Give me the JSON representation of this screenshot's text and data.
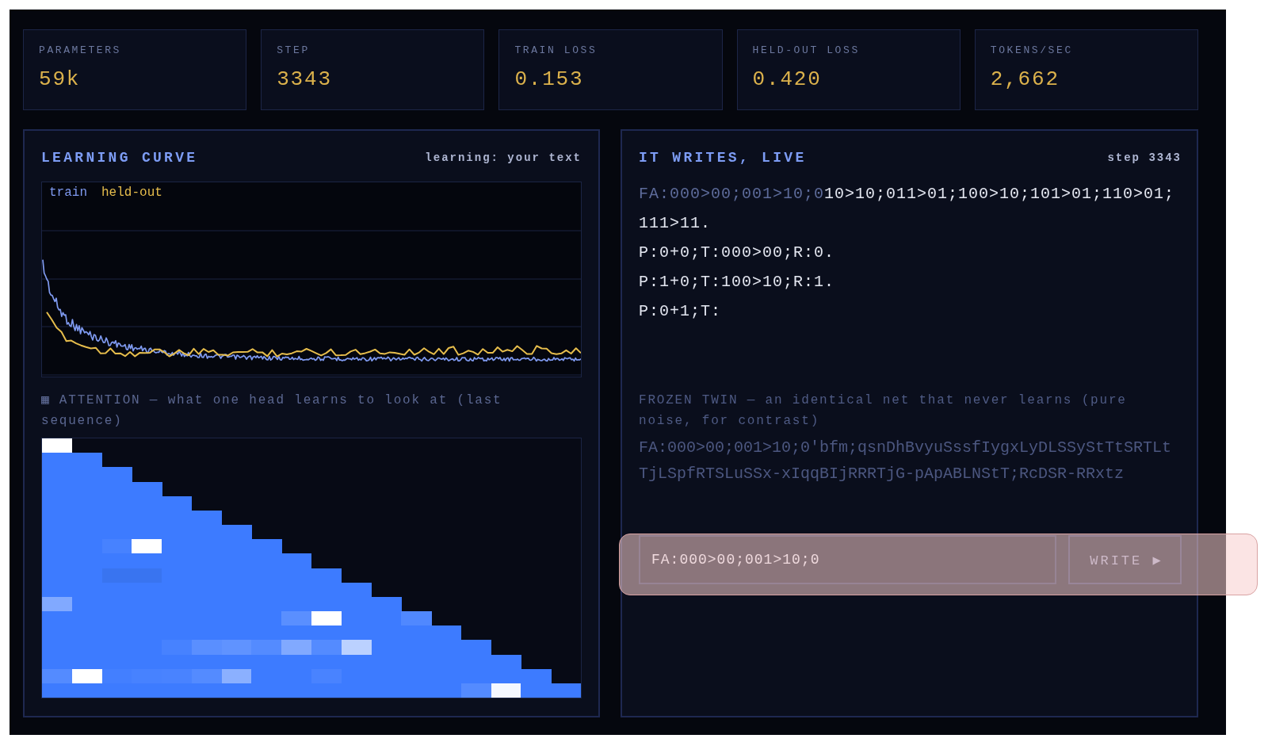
{
  "stats": [
    {
      "label": "PARAMETERS",
      "value": "59k"
    },
    {
      "label": "STEP",
      "value": "3343"
    },
    {
      "label": "TRAIN LOSS",
      "value": "0.153"
    },
    {
      "label": "HELD-OUT LOSS",
      "value": "0.420"
    },
    {
      "label": "TOKENS/SEC",
      "value": "2,662"
    }
  ],
  "learning_curve": {
    "title": "LEARNING CURVE",
    "source": "learning: your text",
    "legend": [
      {
        "label": "train",
        "color": "#7f9af0"
      },
      {
        "label": "held-out",
        "color": "#e6bd4c"
      }
    ]
  },
  "attention": {
    "caption": "▦ ATTENTION — what one head learns to look at (last sequence)"
  },
  "live_output": {
    "title": "IT WRITES, LIVE",
    "step": "step 3343",
    "prompt": "FA:000>00;001>10;0",
    "continuation": "10>10;011>01;100>10;101>01;110>01;111>11.\nP:0+0;T:000>00;R:0.\nP:1+0;T:100>10;R:1.\nP:0+1;T:"
  },
  "frozen_twin": {
    "caption": "FROZEN TWIN — an identical net that never learns (pure noise, for contrast)",
    "output": "FA:000>00;001>10;0'bfm;qsnDhBvyuSssfIygxLyDLSSyStTtSRTLtTjLSpfRTSLuSSx-xIqqBIjRRRTjG-pApABLNStT;RcDSR-RRxtz"
  },
  "prompt_input": {
    "value": "FA:000>00;001>10;0"
  },
  "write_button": {
    "label": "WRITE ▶"
  }
}
